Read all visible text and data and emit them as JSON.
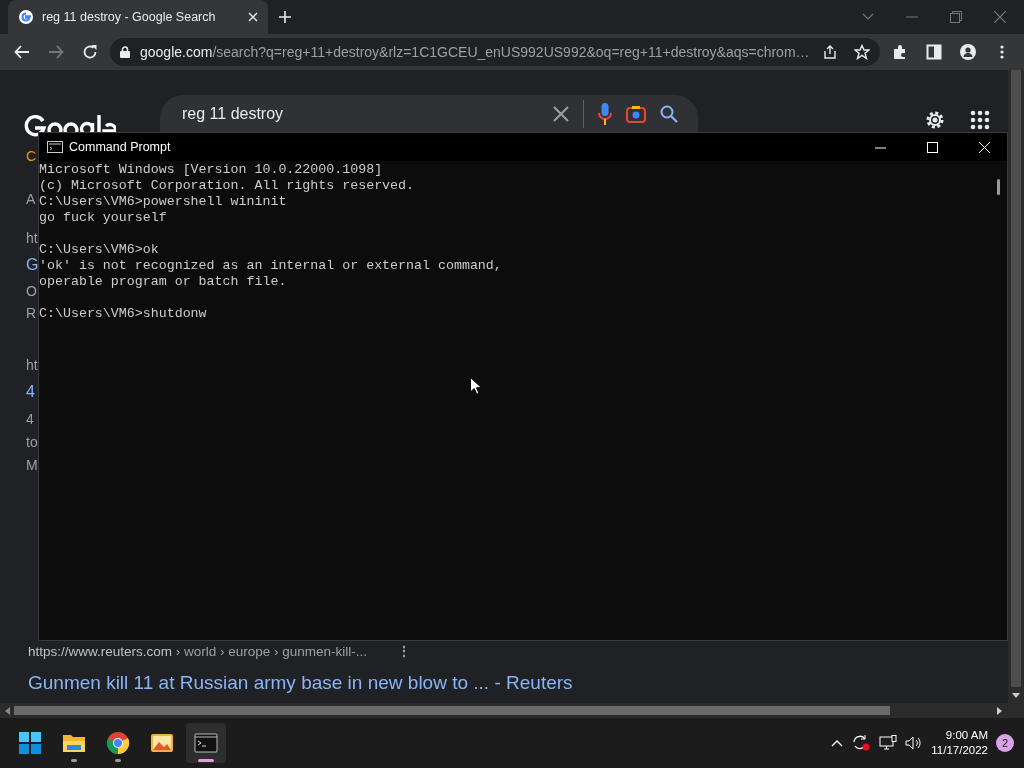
{
  "browser": {
    "tab": {
      "title": "reg 11 destroy - Google Search",
      "selected": true
    },
    "forward": {
      "disabled": true
    },
    "url": {
      "domain": "google.com",
      "path": "/search?q=reg+11+destroy&rlz=1C1GCEU_enUS992US992&oq=reg+11+destroy&aqs=chrom…"
    }
  },
  "google": {
    "search_value": "reg 11 destroy"
  },
  "fragments": [
    {
      "text": "C",
      "kind": "tab"
    },
    {
      "text": "A",
      "kind": "text"
    },
    {
      "text": "ht",
      "kind": "text"
    },
    {
      "text": "G",
      "kind": "heading"
    },
    {
      "text": "O",
      "kind": "text"
    },
    {
      "text": "R",
      "kind": "text"
    },
    {
      "text": "ht",
      "kind": "text"
    },
    {
      "text": "4",
      "kind": "heading"
    },
    {
      "text": "4",
      "kind": "text"
    },
    {
      "text": "to",
      "kind": "text"
    },
    {
      "text": "M",
      "kind": "text"
    }
  ],
  "result": {
    "site": "https://www.reuters.com",
    "breadcrumb": "› world › europe › gunmen-kill-...",
    "menu": "⋮",
    "title": "Gunmen kill 11 at Russian army base in new blow to ... - Reuters"
  },
  "cmd": {
    "title": "Command Prompt",
    "blocks": [
      [
        "Microsoft Windows [Version 10.0.22000.1098]",
        "(c) Microsoft Corporation. All rights reserved.",
        "C:\\Users\\VM6>powershell wininit",
        "go fuck yourself"
      ],
      [
        "C:\\Users\\VM6>ok",
        "'ok' is not recognized as an internal or external command,",
        "operable program or batch file."
      ],
      [
        "C:\\Users\\VM6>shutdonw"
      ]
    ]
  },
  "taskbar": {
    "apps": [
      {
        "kind": "start",
        "running": false,
        "selected": false
      },
      {
        "kind": "explorer",
        "running": true,
        "selected": false
      },
      {
        "kind": "chrome",
        "running": true,
        "selected": false
      },
      {
        "kind": "photos",
        "running": false,
        "selected": false
      },
      {
        "kind": "terminal",
        "running": true,
        "selected": true
      }
    ],
    "time": "9:00 AM",
    "date": "11/17/2022",
    "notifications": "2"
  }
}
